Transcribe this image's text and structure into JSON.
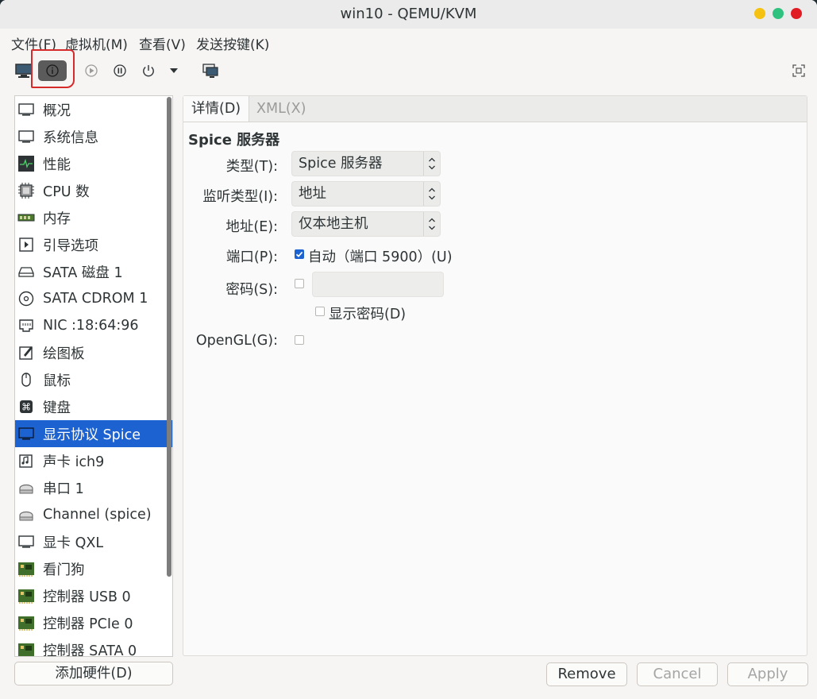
{
  "window": {
    "title": "win10 - QEMU/KVM"
  },
  "menu": [
    "文件(F)",
    "虚拟机(M)",
    "查看(V)",
    "发送按键(K)"
  ],
  "toolbar": {
    "buttons": [
      "monitor-icon",
      "info-icon",
      "play-icon",
      "pause-icon",
      "power-icon",
      "dropdown-arrow-icon",
      "snapshot-icon",
      "fullscreen-icon"
    ],
    "active": "info-icon"
  },
  "sidebar": {
    "items": [
      {
        "label": "概况",
        "icon": "overview-icon"
      },
      {
        "label": "系统信息",
        "icon": "system-info-icon"
      },
      {
        "label": "性能",
        "icon": "performance-icon"
      },
      {
        "label": "CPU 数",
        "icon": "cpu-icon"
      },
      {
        "label": "内存",
        "icon": "memory-icon"
      },
      {
        "label": "引导选项",
        "icon": "boot-icon"
      },
      {
        "label": "SATA 磁盘 1",
        "icon": "disk-icon"
      },
      {
        "label": "SATA CDROM 1",
        "icon": "cdrom-icon"
      },
      {
        "label": "NIC :18:64:96",
        "icon": "nic-icon"
      },
      {
        "label": "绘图板",
        "icon": "tablet-icon"
      },
      {
        "label": "鼠标",
        "icon": "mouse-icon"
      },
      {
        "label": "键盘",
        "icon": "keyboard-icon"
      },
      {
        "label": "显示协议 Spice",
        "icon": "display-icon"
      },
      {
        "label": "声卡 ich9",
        "icon": "sound-icon"
      },
      {
        "label": "串口 1",
        "icon": "serial-icon"
      },
      {
        "label": "Channel (spice)",
        "icon": "channel-icon"
      },
      {
        "label": "显卡 QXL",
        "icon": "video-icon"
      },
      {
        "label": "看门狗",
        "icon": "watchdog-icon"
      },
      {
        "label": "控制器 USB 0",
        "icon": "controller-icon"
      },
      {
        "label": "控制器 PCIe 0",
        "icon": "controller-icon"
      },
      {
        "label": "控制器 SATA 0",
        "icon": "controller-icon"
      }
    ],
    "selected_label": "显示协议 Spice",
    "add_hardware": "添加硬件(D)"
  },
  "tabs": {
    "details": "详情(D)",
    "xml": "XML(X)"
  },
  "form": {
    "section_title": "Spice 服务器",
    "type_label": "类型(T):",
    "type_value": "Spice 服务器",
    "listen_label": "监听类型(I):",
    "listen_value": "地址",
    "address_label": "地址(E):",
    "address_value": "仅本地主机",
    "port_label": "端口(P):",
    "port_auto": "自动（端口 5900）(U)",
    "port_auto_checked": true,
    "password_label": "密码(S):",
    "password_checked": false,
    "show_password": "显示密码(D)",
    "opengl_label": "OpenGL(G):",
    "opengl_checked": false
  },
  "buttons": {
    "remove": "Remove",
    "cancel": "Cancel",
    "apply": "Apply"
  },
  "colors": {
    "selection": "#1c62d1",
    "annotation": "#d52b2b"
  }
}
